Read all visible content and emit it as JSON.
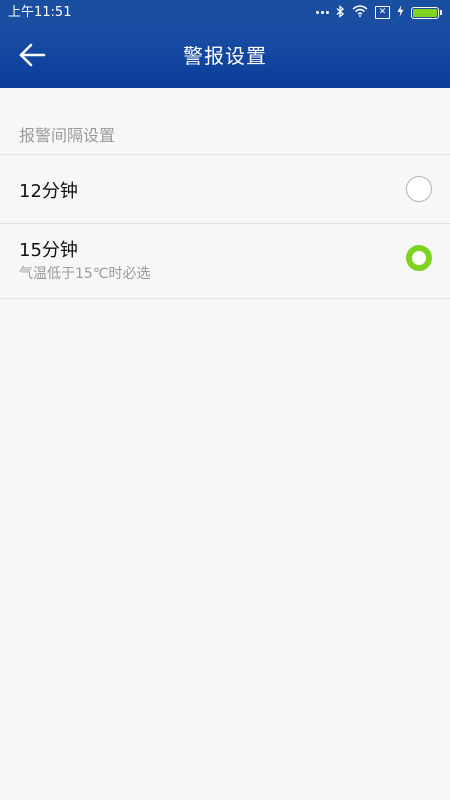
{
  "status_bar": {
    "time": "上午11:51",
    "bluetooth_icon": "bluetooth-icon",
    "wifi_icon": "wifi-icon",
    "sim_icon": "no-sim-icon",
    "sim_glyph": "✕",
    "charging_icon": "charging-bolt-icon",
    "battery_icon": "battery-icon",
    "battery_level": 1.0,
    "battery_color": "#7ed321"
  },
  "app_bar": {
    "title": "警报设置",
    "back_icon": "back-arrow-icon",
    "background_color": "#0d4299"
  },
  "section": {
    "header": "报警间隔设置"
  },
  "options": [
    {
      "label": "12分钟",
      "hint": "",
      "selected": false
    },
    {
      "label": "15分钟",
      "hint": "气温低于15℃时必选",
      "selected": true
    }
  ],
  "colors": {
    "accent": "#7ed321",
    "page_background": "#f7f7f7",
    "muted_text": "#9a9a9a"
  }
}
